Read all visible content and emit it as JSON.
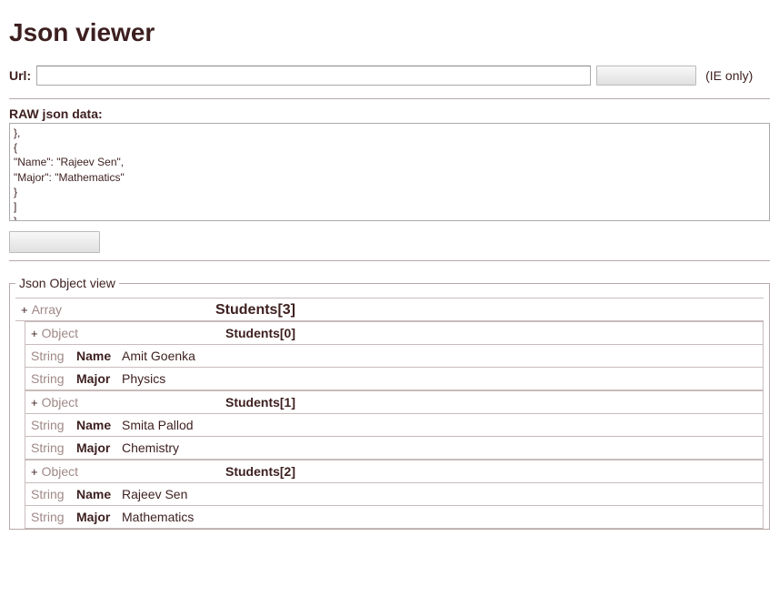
{
  "title": "Json viewer",
  "url": {
    "label": "Url:",
    "value": "",
    "suffix": "(IE only)"
  },
  "raw": {
    "label": "RAW json data:",
    "value": "},\n{\n\"Name\": \"Rajeev Sen\",\n\"Major\": \"Mathematics\"\n}\n]\n}"
  },
  "legend": "Json Object view",
  "types": {
    "array": "Array",
    "object": "Object",
    "string": "String"
  },
  "tree": {
    "rootKey": "Students[3]",
    "items": [
      {
        "key": "Students[0]",
        "props": [
          {
            "type": "String",
            "k": "Name",
            "v": "Amit Goenka"
          },
          {
            "type": "String",
            "k": "Major",
            "v": "Physics"
          }
        ]
      },
      {
        "key": "Students[1]",
        "props": [
          {
            "type": "String",
            "k": "Name",
            "v": "Smita Pallod"
          },
          {
            "type": "String",
            "k": "Major",
            "v": "Chemistry"
          }
        ]
      },
      {
        "key": "Students[2]",
        "props": [
          {
            "type": "String",
            "k": "Name",
            "v": "Rajeev Sen"
          },
          {
            "type": "String",
            "k": "Major",
            "v": "Mathematics"
          }
        ]
      }
    ]
  }
}
